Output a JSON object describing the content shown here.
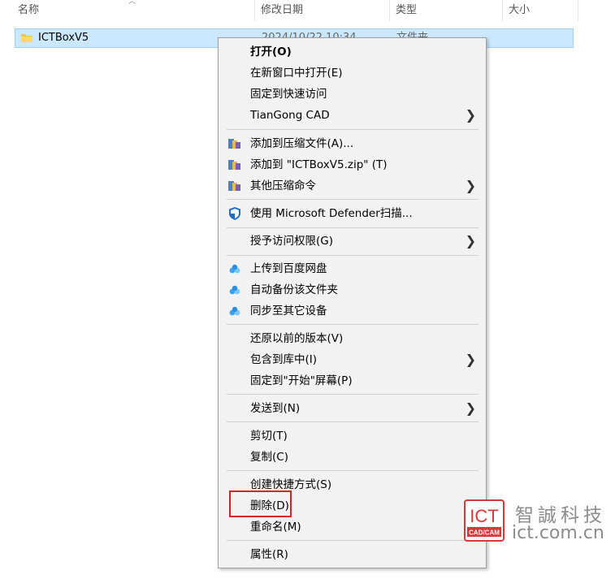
{
  "header": {
    "name": "名称",
    "modified": "修改日期",
    "type": "类型",
    "size": "大小"
  },
  "file_row": {
    "name": "ICTBoxV5",
    "date": "2024/10/22 10:34",
    "type": "文件夹"
  },
  "menu": {
    "open": "打开(O)",
    "open_new_window": "在新窗口中打开(E)",
    "pin_quick_access": "固定到快速访问",
    "tiangong": "TianGong CAD",
    "add_archive": "添加到压缩文件(A)...",
    "add_zip": "添加到 \"ICTBoxV5.zip\" (T)",
    "other_compress": "其他压缩命令",
    "defender": "使用 Microsoft Defender扫描...",
    "grant_access": "授予访问权限(G)",
    "upload_baidu": "上传到百度网盘",
    "auto_backup": "自动备份该文件夹",
    "sync_devices": "同步至其它设备",
    "restore_versions": "还原以前的版本(V)",
    "include_library": "包含到库中(I)",
    "pin_start": "固定到\"开始\"屏幕(P)",
    "send_to": "发送到(N)",
    "cut": "剪切(T)",
    "copy": "复制(C)",
    "create_shortcut": "创建快捷方式(S)",
    "delete": "删除(D)",
    "rename": "重命名(M)",
    "properties": "属性(R)"
  },
  "watermark": {
    "logo_text": "ICT",
    "logo_sub": "CAD/CAM",
    "company": "智誠科技",
    "url": "ict.com.cn"
  },
  "colors": {
    "selection": "#cce8ff",
    "highlight_box": "#e02020",
    "logo_red": "#d9383a"
  },
  "icons": {
    "folder": "folder-icon",
    "archive": "winrar-archive-icon",
    "defender": "defender-shield-icon",
    "baidu": "baidu-netdisk-icon",
    "submenu": "chevron-right-icon"
  }
}
